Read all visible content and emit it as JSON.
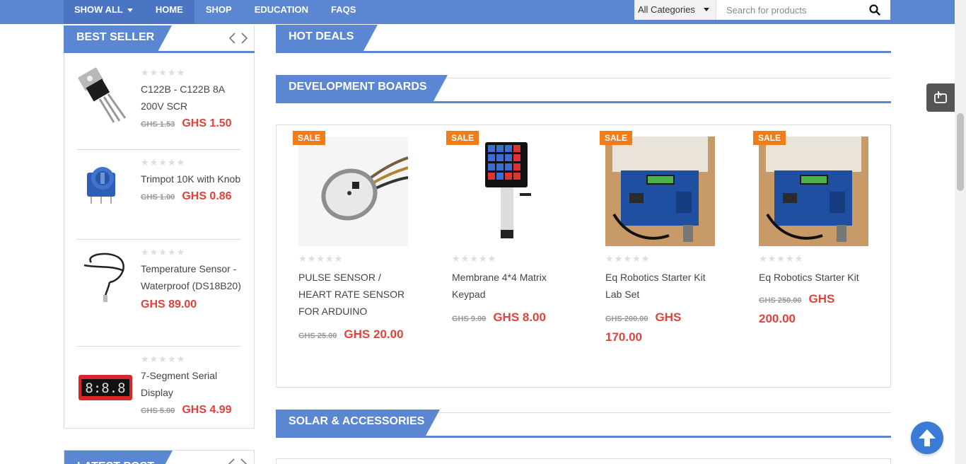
{
  "nav": {
    "show_all": "SHOW ALL",
    "items": [
      "HOME",
      "SHOP",
      "EDUCATION",
      "FAQS"
    ],
    "active": "HOME"
  },
  "search": {
    "category": "All Categories",
    "placeholder": "Search for products"
  },
  "sidebar": {
    "title": "BEST SELLER",
    "latest_title": "LATEST POST",
    "items": [
      {
        "name": "C122B - C122B 8A 200V SCR",
        "old_price": "GHS 1.53",
        "price": "GHS 1.50"
      },
      {
        "name": "Trimpot 10K with Knob",
        "old_price": "GHS 1.00",
        "price": "GHS 0.86"
      },
      {
        "name": "Temperature Sensor - Waterproof (DS18B20)",
        "old_price": "",
        "price": "GHS 89.00"
      },
      {
        "name": "7-Segment Serial Display",
        "old_price": "GHS 5.00",
        "price": "GHS 4.99"
      }
    ]
  },
  "sections": {
    "hot_deals": "HOT DEALS",
    "dev_boards": "DEVELOPMENT BOARDS",
    "solar": "SOLAR & ACCESSORIES"
  },
  "products": [
    {
      "badge": "SALE",
      "name": "PULSE SENSOR / HEART RATE SENSOR FOR ARDUINO",
      "old_price": "GHS 25.00",
      "price": "GHS 20.00"
    },
    {
      "badge": "SALE",
      "name": "Membrane 4*4 Matrix Keypad",
      "old_price": "GHS 9.00",
      "price": "GHS 8.00"
    },
    {
      "badge": "SALE",
      "name": "Eq Robotics Starter Kit Lab Set",
      "old_price": "GHS 200.00",
      "price": "GHS 170.00"
    },
    {
      "badge": "SALE",
      "name": "Eq Robotics Starter Kit",
      "old_price": "GHS 250.00",
      "price": "GHS 200.00"
    }
  ],
  "stars": "★★★★★",
  "colors": {
    "primary": "#5b86d1",
    "sale": "#ef7d1a",
    "price": "#e0433d"
  }
}
